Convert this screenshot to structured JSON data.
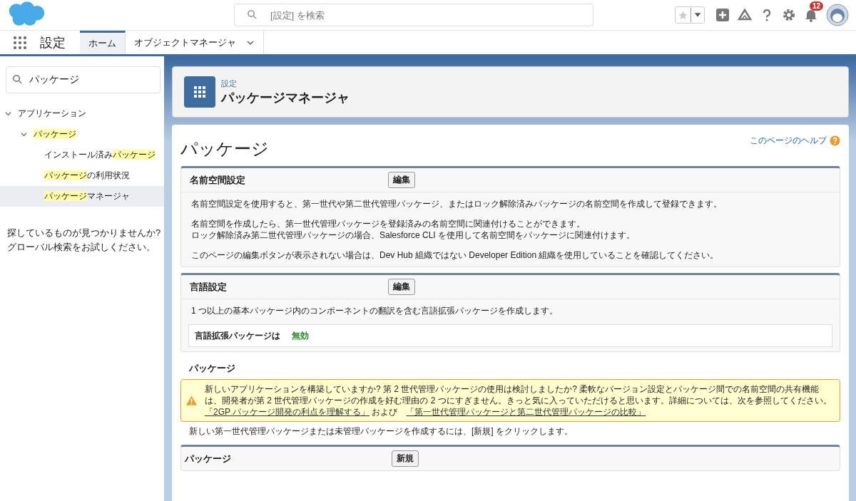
{
  "header": {
    "search": {
      "placeholder": "[設定] を検索"
    },
    "notifications": "12"
  },
  "nav": {
    "app_name": "設定",
    "tabs": [
      {
        "label": "ホーム",
        "selected": true,
        "dropdown": false
      },
      {
        "label": "オブジェクトマネージャ",
        "selected": false,
        "dropdown": true
      }
    ]
  },
  "sidebar": {
    "search": {
      "value": "パッケージ"
    },
    "tree": [
      {
        "parts": [
          {
            "text": "アプリケーション",
            "highlighted": false
          }
        ],
        "expanded": true,
        "selected": false,
        "children": [
          {
            "parts": [
              {
                "text": "パッケージ",
                "highlighted": true
              }
            ],
            "expanded": true,
            "selected": false,
            "children": [
              {
                "parts": [
                  {
                    "text": "インストール済み",
                    "highlighted": false
                  },
                  {
                    "text": "パッケージ",
                    "highlighted": true
                  }
                ],
                "selected": false
              },
              {
                "parts": [
                  {
                    "text": "パッケージ",
                    "highlighted": true
                  },
                  {
                    "text": "の利用状況",
                    "highlighted": false
                  }
                ],
                "selected": false
              },
              {
                "parts": [
                  {
                    "text": "パッケージ",
                    "highlighted": true
                  },
                  {
                    "text": "マネージャ",
                    "highlighted": false
                  }
                ],
                "selected": true
              }
            ]
          }
        ]
      }
    ],
    "hint": [
      "探しているものが見つかりませんか?",
      "グローバル検索をお試しください。"
    ]
  },
  "page_header": {
    "breadcrumb": "設定",
    "title": "パッケージマネージャ"
  },
  "content": {
    "title": "パッケージ",
    "help_link": "このページのヘルプ",
    "namespace_section": {
      "title": "名前空間設定",
      "button": "編集",
      "paragraphs": [
        [
          "名前空間設定を使用すると、第一世代や第二世代管理パッケージ、またはロック解除済みパッケージの名前空間を作成して登録できます。"
        ],
        [
          "名前空間を作成したら、第一世代管理パッケージを登録済みの名前空間に関連付けることができます。",
          "ロック解除済み第二世代管理パッケージの場合、Salesforce CLI を使用して名前空間をパッケージに関連付けます。"
        ],
        [
          "このページの編集ボタンが表示されない場合は、Dev Hub 組織ではない Developer Edition 組織を使用していることを確認してください。"
        ]
      ]
    },
    "language_section": {
      "title": "言語設定",
      "button": "編集",
      "description": "1 つ以上の基本パッケージ内のコンポーネントの翻訳を含む言語拡張パッケージを作成します。",
      "field_label": "言語拡張パッケージは",
      "field_value": "無効"
    },
    "packages_heading": "パッケージ",
    "warning": {
      "text": "新しいアプリケーションを構築していますか? 第 2 世代管理パッケージの使用は検討しましたか? 柔軟なバージョン設定とパッケージ間での名前空間の共有機能は、開発者が第 2 世代管理パッケージの作成を好む理由の 2 つにすぎません。きっと気に入っていただけると思います。詳細については、次を参照してください。",
      "link1": "「2GP パッケージ開発の利点を理解する」",
      "and": "および",
      "link2": "「第一世代管理パッケージと第二世代管理パッケージの比較」"
    },
    "instruction": "新しい第一世代管理パッケージまたは未管理パッケージを作成するには、[新規] をクリックします。",
    "packages_section": {
      "title": "パッケージ",
      "button": "新規"
    }
  }
}
